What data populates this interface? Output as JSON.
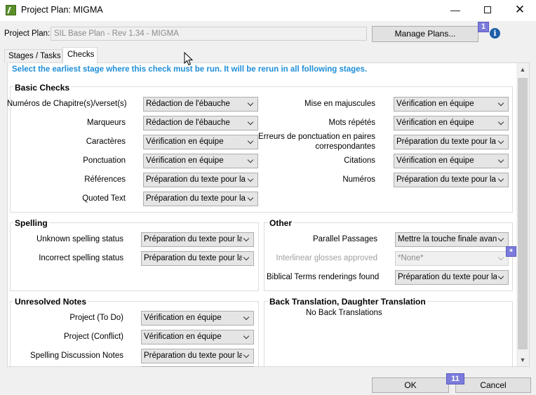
{
  "window": {
    "title": "Project Plan: MIGMA"
  },
  "project_plan": {
    "label": "Project Plan:",
    "value": "SIL Base Plan - Rev 1.34 - MIGMA",
    "manage_button": "Manage Plans...",
    "badge": "1"
  },
  "tabs": [
    "Stages / Tasks",
    "Checks"
  ],
  "instruction": "Select the earliest stage where this check must be run.  It will be rerun in all following stages.",
  "basic_checks": {
    "title": "Basic Checks",
    "left": [
      {
        "label": "Numéros de Chapitre(s)/verset(s)",
        "value": "Rédaction de l'ébauche"
      },
      {
        "label": "Marqueurs",
        "value": "Rédaction de l'ébauche"
      },
      {
        "label": "Caractères",
        "value": "Vérification en équipe"
      },
      {
        "label": "Ponctuation",
        "value": "Vérification en équipe"
      },
      {
        "label": "Références",
        "value": "Préparation du texte pour la vé"
      },
      {
        "label": "Quoted Text",
        "value": "Préparation du texte pour la vé"
      }
    ],
    "right": [
      {
        "label": "Mise en majuscules",
        "value": "Vérification en équipe"
      },
      {
        "label": "Mots répétés",
        "value": "Vérification en équipe"
      },
      {
        "label": "Erreurs de ponctuation en paires correspondantes",
        "label_line1": "Erreurs de ponctuation en paires",
        "label_line2": "correspondantes",
        "value": "Préparation du texte pour la vé"
      },
      {
        "label": "Citations",
        "value": "Vérification en équipe"
      },
      {
        "label": "Numéros",
        "value": "Préparation du texte pour la vé"
      }
    ]
  },
  "spelling": {
    "title": "Spelling",
    "rows": [
      {
        "label": "Unknown spelling status",
        "value": "Préparation du texte pour la v"
      },
      {
        "label": "Incorrect spelling status",
        "value": "Préparation du texte pour la v"
      }
    ]
  },
  "other": {
    "title": "Other",
    "rows": [
      {
        "label": "Parallel Passages",
        "value": "Mettre la touche finale avant"
      },
      {
        "label": "Interlinear glosses approved",
        "value": "*None*"
      },
      {
        "label": "Biblical Terms renderings found",
        "value": "Préparation du texte pour la vé"
      }
    ],
    "badge": "*"
  },
  "unresolved_notes": {
    "title": "Unresolved Notes",
    "rows": [
      {
        "label": "Project (To Do)",
        "value": "Vérification en équipe"
      },
      {
        "label": "Project (Conflict)",
        "value": "Vérification en équipe"
      },
      {
        "label": "Spelling Discussion Notes",
        "value": "Préparation du texte pour la v"
      }
    ]
  },
  "back_translation": {
    "title": "Back Translation, Daughter Translation",
    "message": "No Back Translations"
  },
  "footer": {
    "ok": "OK",
    "cancel": "Cancel",
    "badge": "11"
  }
}
